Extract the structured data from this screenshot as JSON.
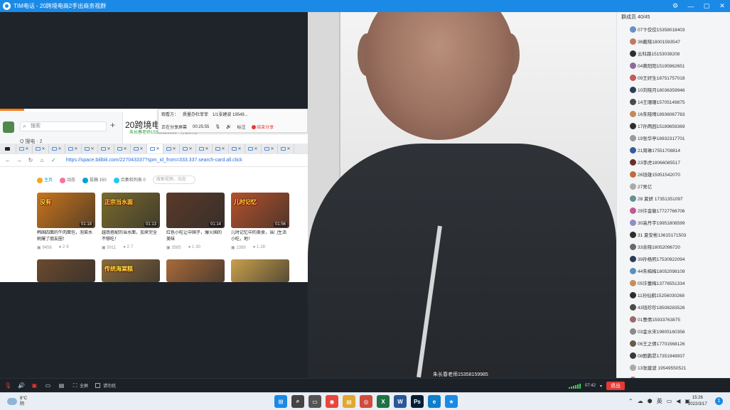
{
  "window": {
    "title": "TIM电话 - 20跨境电商2手出商务视群",
    "buttons": [
      "⚙",
      "—",
      "▢",
      "✕"
    ]
  },
  "share": {
    "tim_search_placeholder": "搜索",
    "tim_subline": "Q 搜电 · 2",
    "header_title": "20跨境电商",
    "header_sub": "朱长春老师15358159985 · 分享屏幕",
    "toolbar": {
      "viewers_label": "观看方：",
      "viewer1": "质量办杜菲菲",
      "viewer2": "1/1张建波 19549...",
      "status": "正在分享屏幕",
      "timer": "00:25:55",
      "annotate": "标注",
      "stop": "结束分享"
    }
  },
  "browser": {
    "tabs": [
      "",
      "✕",
      "✕",
      "✕",
      "✕",
      "✕",
      "✕",
      "✕",
      "✕",
      "✕",
      "✕",
      "✕",
      "✕",
      "✕",
      "✕",
      "✕",
      "✕",
      "✕"
    ],
    "active_tab": 9,
    "url": "https://space.bilibili.com/227043337?spm_id_from=333.337.search-card.all.click",
    "nav": {
      "home": "主页",
      "dynamic": "动态",
      "posts": "投稿",
      "posts_count": "150",
      "collections": "合集和列表",
      "collections_count": "0",
      "search_placeholder": "搜索视频、动态"
    }
  },
  "videos": [
    {
      "caption": "没有",
      "duration": "01:18",
      "title": "韩国四面的牛肉面包，泡菜水刷爆了朋友圈！",
      "plays": "9456",
      "comments": "2·9",
      "color": "#c9751c"
    },
    {
      "caption": "正宗当水面",
      "duration": "01:13",
      "title": "越南搭配的当水面，加来完全不够吃！",
      "plays": "5011",
      "comments": "2·7",
      "color": "#7a6a2e"
    },
    {
      "caption": "",
      "duration": "01:14",
      "title": "红色小吃让中国子，爆火国的美味",
      "plays": "3585",
      "comments": "1·30",
      "color": "#5a3a2a"
    },
    {
      "caption": "儿时记忆",
      "duration": "01:56",
      "title": "儿时记忆中的美食，当门生活小吃，地！",
      "plays": "1389",
      "comments": "1·28",
      "color": "#b3522c"
    },
    {
      "caption": "",
      "duration": "",
      "title": "",
      "plays": "",
      "comments": "",
      "color": "#6b4a2e"
    },
    {
      "caption": "传统海棠糕",
      "duration": "",
      "title": "",
      "plays": "",
      "comments": "",
      "color": "#8a6a3c"
    },
    {
      "caption": "",
      "duration": "",
      "title": "",
      "plays": "",
      "comments": "",
      "color": "#a86a3a"
    },
    {
      "caption": "",
      "duration": "",
      "title": "",
      "plays": "",
      "comments": "",
      "color": "#c9a04c"
    }
  ],
  "video": {
    "speaker_caption": "朱长春老师15358159985"
  },
  "members": {
    "header": "群成员 40/45",
    "list": [
      "07卞佼佼15358018403",
      "36戴晓18001593547",
      "云科路15153039208",
      "04黄阳阳15195962651",
      "09王好生18751757018",
      "10刘晓月18036359946",
      "14王珊珊15705149875",
      "16朱晓晴18936067783",
      "17孙两园15189659369",
      "19张华亭18932317701",
      "21周琳17551708814",
      "23李虎18066085517",
      "26钱雄15951542070",
      "27吴亿",
      "28 夏妍 17351351097",
      "29许金敏17727766706",
      "30高丹宇19951808599",
      "31 夏安彬13615171503",
      "33余晓18052096720",
      "39孙杨熙17530922094",
      "44朱梅梅18052098109",
      "05许蕾梅13776551334",
      "11孙仙鹤15256030268",
      "43钱珍珍18508283526",
      "01曹倩15933763875",
      "03金水宋19805160356",
      "06王之倩17701568126",
      "08鲍鹏昂17351948937",
      "13张建波 19549550521",
      "18周同顺13182950179"
    ],
    "avatar_colors": [
      "#6a8fc4",
      "#c47a5a",
      "#2e2e2e",
      "#8f6a9c",
      "#c45a5a",
      "#2e3e5a",
      "#4a4a4a",
      "#c48a5a",
      "#2e2e2e",
      "#9a9a9a",
      "#3a5a9c",
      "#6a2e2e",
      "#c46a3a",
      "#aaa",
      "#6a8f8f",
      "#c45a8f",
      "#8f8fc4",
      "#2e2e2e",
      "#6a6a6a",
      "#2e3a5a",
      "#5a8fc4",
      "#c48f5a",
      "#2e2e2e",
      "#4a4a4a",
      "#9a6a6a",
      "#8a8a8a",
      "#6a5a4a",
      "#3a3a3a",
      "#aaa",
      "#c46a6a"
    ]
  },
  "toolbar": {
    "fullscreen": "全屏",
    "no_disturb": "请勿扰",
    "time": "07:42",
    "leave": "退出"
  },
  "taskbar": {
    "temp": "8°C",
    "weather": "阴",
    "apps": [
      {
        "label": "⊞",
        "color": "#1a8ae6"
      },
      {
        "label": "⌕",
        "color": "#444"
      },
      {
        "label": "▭",
        "color": "#555"
      },
      {
        "label": "◉",
        "color": "#e8453c"
      },
      {
        "label": "▤",
        "color": "#e0a82e"
      },
      {
        "label": "◎",
        "color": "#d14b3d"
      },
      {
        "label": "X",
        "color": "#1e7145"
      },
      {
        "label": "W",
        "color": "#2b579a"
      },
      {
        "label": "Ps",
        "color": "#001e36"
      },
      {
        "label": "e",
        "color": "#0f7fc9"
      },
      {
        "label": "★",
        "color": "#1a8ae6"
      }
    ],
    "tray_icons": [
      "⌃",
      "☁",
      "⬢",
      "英",
      "▭",
      "◀",
      "▣"
    ],
    "time": "15:26",
    "date": "2022/3/17",
    "notify_count": "1"
  }
}
